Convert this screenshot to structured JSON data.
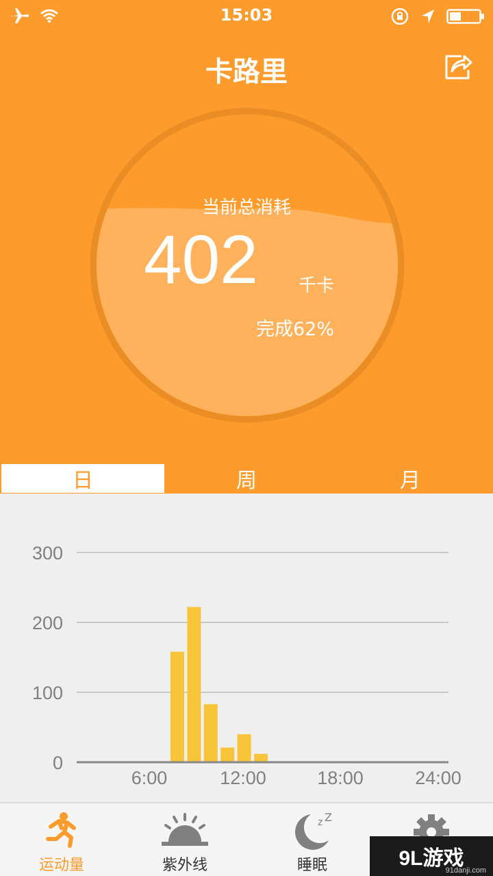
{
  "status": {
    "time": "15:03"
  },
  "header": {
    "title": "卡路里"
  },
  "summary": {
    "label": "当前总消耗",
    "value": "402",
    "unit": "千卡",
    "progress_text": "完成62%",
    "progress_fraction": 0.62
  },
  "tabs": [
    {
      "label": "日",
      "active": true
    },
    {
      "label": "周",
      "active": false
    },
    {
      "label": "月",
      "active": false
    }
  ],
  "chart_data": {
    "type": "bar",
    "x": [
      8,
      9,
      10,
      11,
      12,
      13
    ],
    "values": [
      158,
      222,
      83,
      21,
      40,
      12
    ],
    "xticks": [
      "6:00",
      "12:00",
      "18:00",
      "24:00"
    ],
    "xtick_values": [
      6,
      12,
      18,
      24
    ],
    "yticks": [
      "300",
      "200",
      "100",
      "0"
    ],
    "ytick_values": [
      300,
      200,
      100,
      0
    ],
    "xlim": [
      0,
      24
    ],
    "ylim": [
      0,
      300
    ],
    "grid": true,
    "bar_color": "#f7c43a"
  },
  "bottom_nav": [
    {
      "label": "运动量",
      "icon": "running-icon",
      "active": true
    },
    {
      "label": "紫外线",
      "icon": "sun-icon",
      "active": false
    },
    {
      "label": "睡眠",
      "icon": "moon-sleep-icon",
      "active": false
    },
    {
      "label": "",
      "icon": "gear-icon",
      "active": false
    }
  ],
  "watermark": {
    "text": "9L游戏",
    "sub": "91danji.com"
  },
  "colors": {
    "accent": "#fd9b2c",
    "bar": "#f7c43a",
    "background": "#efefef"
  }
}
